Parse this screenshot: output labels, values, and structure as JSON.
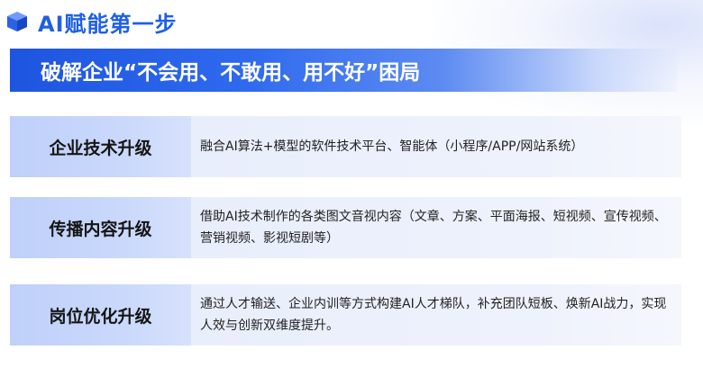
{
  "header": {
    "title": "AI赋能第一步"
  },
  "banner": {
    "text": "破解企业“不会用、不敢用、用不好”困局"
  },
  "rows": [
    {
      "label": "企业技术升级",
      "desc": "融合AI算法+模型的软件技术平台、智能体（小程序/APP/网站系统）"
    },
    {
      "label": "传播内容升级",
      "desc": "借助AI技术制作的各类图文音视内容（文章、方案、平面海报、短视频、宣传视频、营销视频、影视短剧等）"
    },
    {
      "label": "岗位优化升级",
      "desc": "通过人才输送、企业内训等方式构建AI人才梯队，补充团队短板、焕新AI战力，实现人效与创新双维度提升。"
    }
  ],
  "colors": {
    "accent": "#1f5fe6",
    "banner": "#1e55e0",
    "label_bg": "#c4d4fa",
    "desc_bg": "#eef2fc"
  }
}
